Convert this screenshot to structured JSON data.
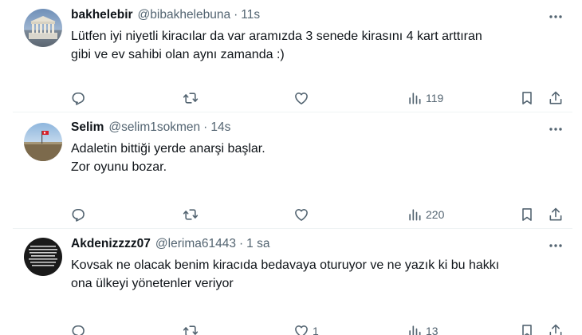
{
  "tweets": [
    {
      "name": "bakhelebir",
      "handle": "@bibakhelebuna",
      "separator": "·",
      "time": "11s",
      "lines": [
        "Lütfen iyi niyetli kiracılar da var aramızda 3 senede kirasını 4 kart arttıran",
        "gibi ve ev sahibi olan aynı zamanda :)"
      ],
      "likes": "",
      "views": "119",
      "avatar_icon": "parthenon-avatar"
    },
    {
      "name": "Selim",
      "handle": "@selim1sokmen",
      "separator": "·",
      "time": "14s",
      "lines": [
        "Adaletin bittiği yerde anarşi başlar.",
        "Zor oyunu bozar."
      ],
      "likes": "",
      "views": "220",
      "avatar_icon": "landscape-flag-avatar"
    },
    {
      "name": "Akdenizzzz07",
      "handle": "@lerima61443",
      "separator": "·",
      "time": "1 sa",
      "lines": [
        "Kovsak ne olacak benim kiracıda bedavaya oturuyor ve ne yazık ki bu hakkı",
        "ona ülkeyi yönetenler veriyor"
      ],
      "likes": "1",
      "views": "13",
      "avatar_icon": "dark-text-avatar"
    }
  ],
  "colors": {
    "text": "#0f1419",
    "secondary": "#536471",
    "divider": "#eff3f4"
  }
}
